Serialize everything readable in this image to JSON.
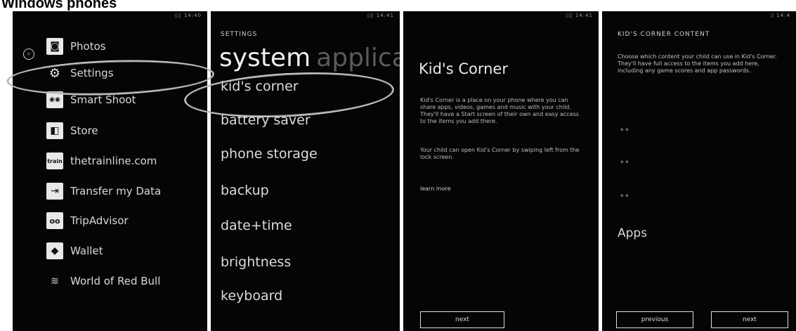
{
  "heading": "Windows phones",
  "phone1": {
    "status": "▯▯ 14:40",
    "search_icon": "search-icon",
    "apps": [
      {
        "label": "Photos",
        "icon": "photos-icon",
        "glyph": "◙"
      },
      {
        "label": "Settings",
        "icon": "gear-icon",
        "glyph": "⚙"
      },
      {
        "label": "Smart Shoot",
        "icon": "smart-shoot-icon",
        "glyph": "◉◉"
      },
      {
        "label": "Store",
        "icon": "store-icon",
        "glyph": "◧"
      },
      {
        "label": "thetrainline.com",
        "icon": "trainline-icon",
        "glyph": "train"
      },
      {
        "label": "Transfer my Data",
        "icon": "transfer-icon",
        "glyph": "⇥"
      },
      {
        "label": "TripAdvisor",
        "icon": "tripadvisor-icon",
        "glyph": "oo"
      },
      {
        "label": "Wallet",
        "icon": "wallet-icon",
        "glyph": "◆"
      },
      {
        "label": "World of Red Bull",
        "icon": "redbull-icon",
        "glyph": "≋"
      }
    ]
  },
  "phone2": {
    "status": "▯▯ 14:41",
    "header": "SETTINGS",
    "pivot_active": "system",
    "pivot_inactive": "applica",
    "items": [
      "kid's corner",
      "battery saver",
      "phone storage",
      "backup",
      "date+time",
      "brightness",
      "keyboard"
    ]
  },
  "phone3": {
    "status": "▯▯ 14:41",
    "title": "Kid's Corner",
    "paragraph1": "Kid's Corner is a place on your phone where you can share apps, videos, games and music with your child. They'll have a Start screen of their own and easy access to the items you add there.",
    "paragraph2": "Your child can open Kid's Corner by swiping left from the lock screen.",
    "learn_more": "learn more",
    "next_button": "next"
  },
  "phone4": {
    "status": "▯ 14:4",
    "header": "KID'S CORNER CONTENT",
    "intro": "Choose which content your child can use in Kid's Corner. They'll have full access to the items you add here, including any game scores and app passwords.",
    "apps_label": "Apps",
    "previous_button": "previous",
    "next_button": "next"
  }
}
